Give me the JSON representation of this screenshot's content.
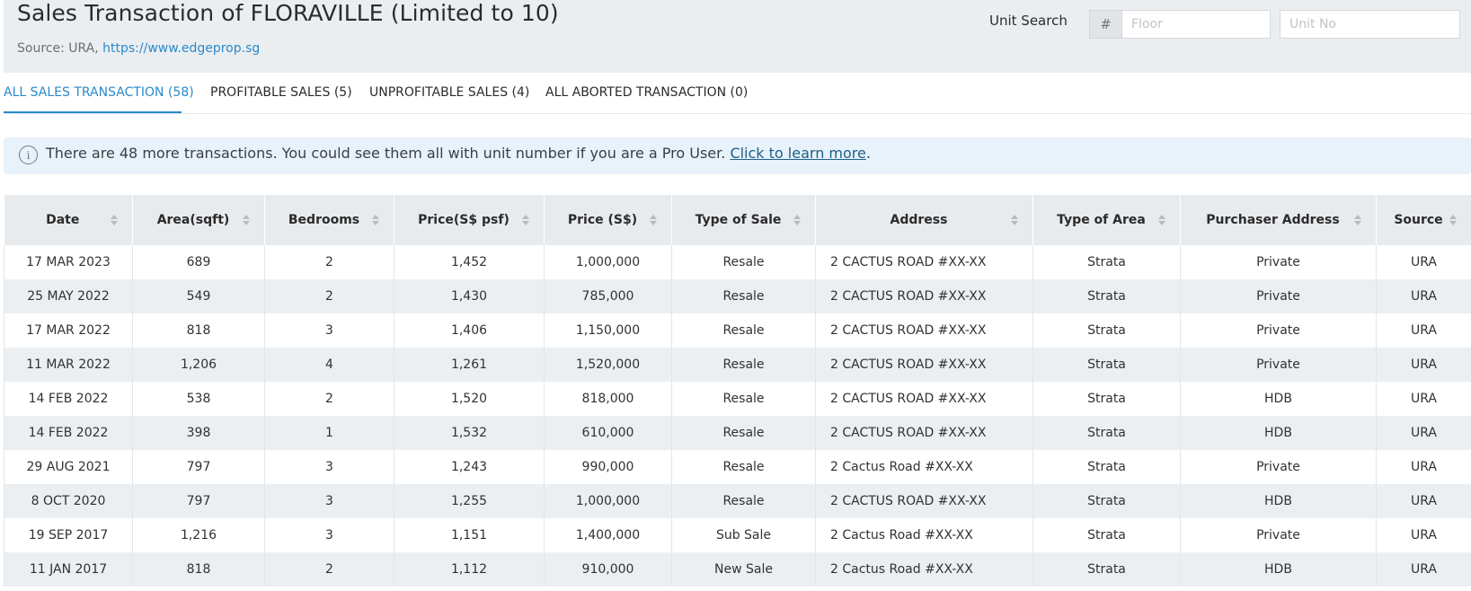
{
  "header": {
    "title": "Sales Transaction of FLORAVILLE (Limited to 10)",
    "source_prefix": "Source: URA, ",
    "source_link": "https://www.edgeprop.sg",
    "unit_search_label": "Unit Search",
    "hash": "#",
    "floor_placeholder": "Floor",
    "unit_placeholder": "Unit No"
  },
  "tabs": [
    {
      "label": "ALL SALES TRANSACTION (58)",
      "active": true
    },
    {
      "label": "PROFITABLE SALES (5)",
      "active": false
    },
    {
      "label": "UNPROFITABLE SALES (4)",
      "active": false
    },
    {
      "label": "ALL ABORTED TRANSACTION (0)",
      "active": false
    }
  ],
  "notice": {
    "icon": "info-icon",
    "text": "There are 48 more transactions. You could see them all with unit number if you are a Pro User. ",
    "link": "Click to learn more",
    "suffix": "."
  },
  "table": {
    "columns": [
      "Date",
      "Area(sqft)",
      "Bedrooms",
      "Price(S$ psf)",
      "Price (S$)",
      "Type of Sale",
      "Address",
      "Type of Area",
      "Purchaser Address",
      "Source"
    ],
    "rows": [
      [
        "17 MAR 2023",
        "689",
        "2",
        "1,452",
        "1,000,000",
        "Resale",
        "2 CACTUS ROAD #XX-XX",
        "Strata",
        "Private",
        "URA"
      ],
      [
        "25 MAY 2022",
        "549",
        "2",
        "1,430",
        "785,000",
        "Resale",
        "2 CACTUS ROAD #XX-XX",
        "Strata",
        "Private",
        "URA"
      ],
      [
        "17 MAR 2022",
        "818",
        "3",
        "1,406",
        "1,150,000",
        "Resale",
        "2 CACTUS ROAD #XX-XX",
        "Strata",
        "Private",
        "URA"
      ],
      [
        "11 MAR 2022",
        "1,206",
        "4",
        "1,261",
        "1,520,000",
        "Resale",
        "2 CACTUS ROAD #XX-XX",
        "Strata",
        "Private",
        "URA"
      ],
      [
        "14 FEB 2022",
        "538",
        "2",
        "1,520",
        "818,000",
        "Resale",
        "2 CACTUS ROAD #XX-XX",
        "Strata",
        "HDB",
        "URA"
      ],
      [
        "14 FEB 2022",
        "398",
        "1",
        "1,532",
        "610,000",
        "Resale",
        "2 CACTUS ROAD #XX-XX",
        "Strata",
        "HDB",
        "URA"
      ],
      [
        "29 AUG 2021",
        "797",
        "3",
        "1,243",
        "990,000",
        "Resale",
        "2 Cactus Road #XX-XX",
        "Strata",
        "Private",
        "URA"
      ],
      [
        "8 OCT 2020",
        "797",
        "3",
        "1,255",
        "1,000,000",
        "Resale",
        "2 CACTUS ROAD #XX-XX",
        "Strata",
        "HDB",
        "URA"
      ],
      [
        "19 SEP 2017",
        "1,216",
        "3",
        "1,151",
        "1,400,000",
        "Sub Sale",
        "2 Cactus Road #XX-XX",
        "Strata",
        "Private",
        "URA"
      ],
      [
        "11 JAN 2017",
        "818",
        "2",
        "1,112",
        "910,000",
        "New Sale",
        "2 Cactus Road #XX-XX",
        "Strata",
        "HDB",
        "URA"
      ]
    ]
  },
  "colors": {
    "accent": "#2a8ac9",
    "header_bg": "#ebeef1",
    "notice_bg": "#e7f2fb",
    "stripe_bg": "#eceff2"
  }
}
